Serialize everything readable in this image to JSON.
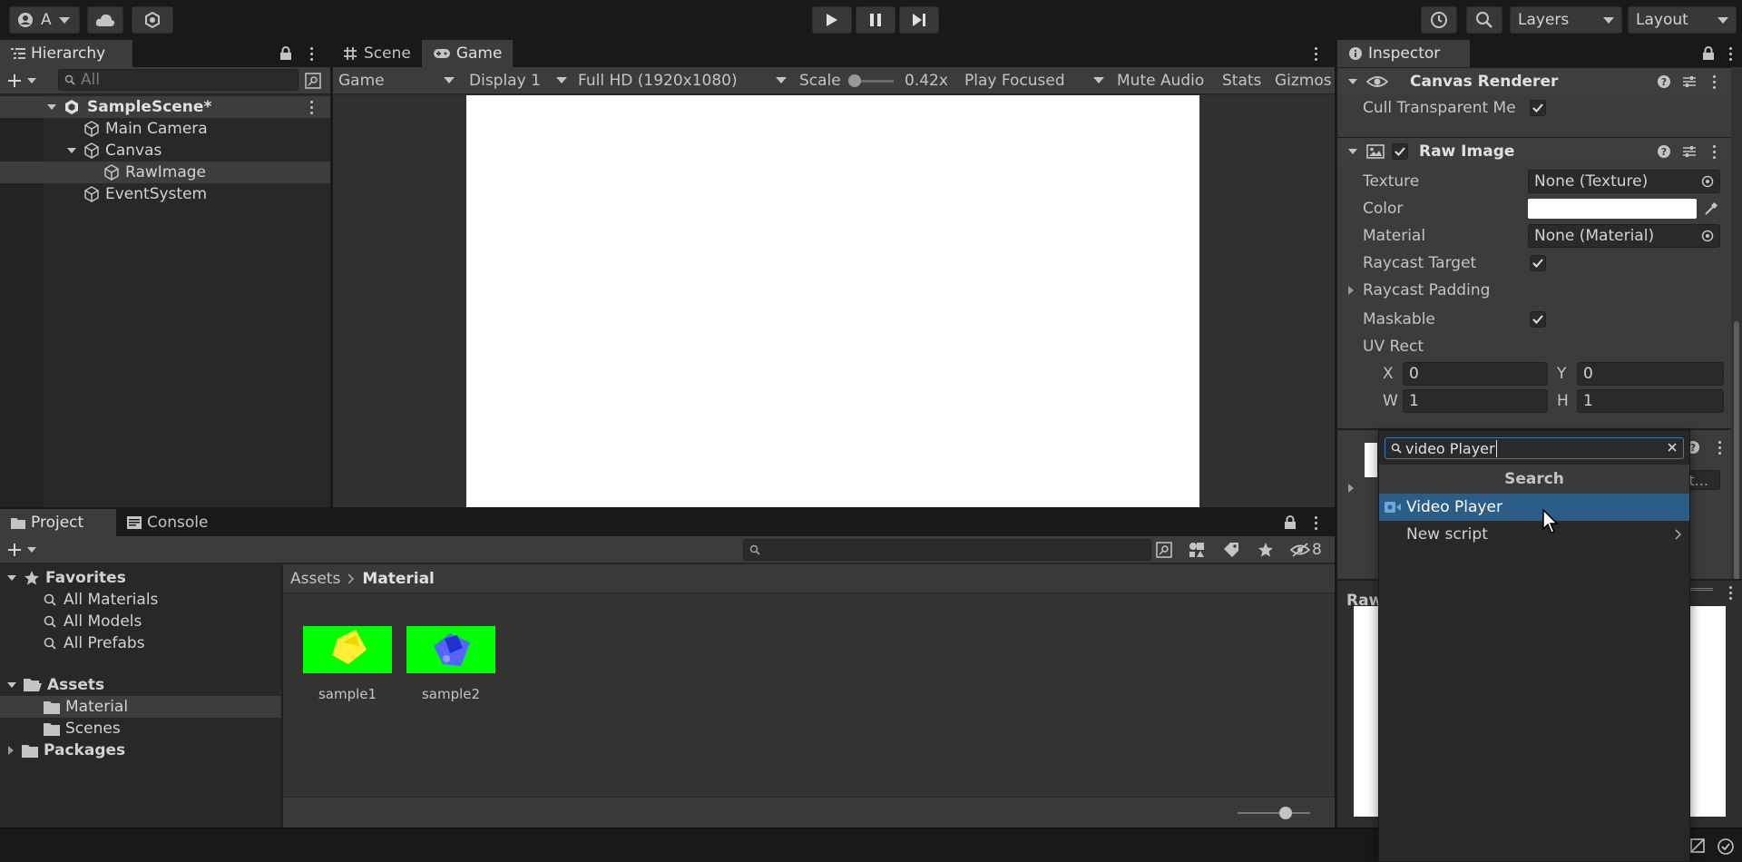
{
  "toolbar": {
    "account_label": "A",
    "layers_label": "Layers",
    "layout_label": "Layout"
  },
  "hierarchy": {
    "tab_label": "Hierarchy",
    "search_placeholder": "All",
    "scene_name": "SampleScene*",
    "items": [
      {
        "label": "Main Camera"
      },
      {
        "label": "Canvas"
      },
      {
        "label": "RawImage"
      },
      {
        "label": "EventSystem"
      }
    ]
  },
  "game_view": {
    "tabs": [
      {
        "label": "Scene"
      },
      {
        "label": "Game"
      }
    ],
    "display_mode": "Game",
    "display": "Display 1",
    "resolution": "Full HD (1920x1080)",
    "scale_label": "Scale",
    "scale_value": "0.42x",
    "play_mode": "Play Focused",
    "mute_audio": "Mute Audio",
    "stats": "Stats",
    "gizmos": "Gizmos"
  },
  "project": {
    "tabs": [
      {
        "label": "Project"
      },
      {
        "label": "Console"
      }
    ],
    "favorites_label": "Favorites",
    "favorites": [
      {
        "label": "All Materials"
      },
      {
        "label": "All Models"
      },
      {
        "label": "All Prefabs"
      }
    ],
    "assets_label": "Assets",
    "asset_folders": [
      {
        "label": "Material"
      },
      {
        "label": "Scenes"
      }
    ],
    "packages_label": "Packages",
    "breadcrumb": [
      "Assets",
      "Material"
    ],
    "hidden_count": "8",
    "files": [
      {
        "label": "sample1",
        "bg": "#00ff00",
        "fg": "#ffee33"
      },
      {
        "label": "sample2",
        "bg": "#00ff00",
        "fg": "#3344ff"
      }
    ]
  },
  "inspector": {
    "tab_label": "Inspector",
    "canvas_renderer": {
      "title": "Canvas Renderer",
      "cull_label": "Cull Transparent Me"
    },
    "raw_image": {
      "title": "Raw Image",
      "texture_label": "Texture",
      "texture_value": "None (Texture)",
      "color_label": "Color",
      "color_value": "#ffffff",
      "material_label": "Material",
      "material_value": "None (Material)",
      "raycast_target_label": "Raycast Target",
      "raycast_padding_label": "Raycast Padding",
      "maskable_label": "Maskable",
      "uv_rect_label": "UV Rect",
      "uv": {
        "x_label": "X",
        "x": "0",
        "y_label": "Y",
        "y": "0",
        "w_label": "W",
        "w": "1",
        "h_label": "H",
        "h": "1"
      }
    },
    "preview_label": "Raw",
    "add_button_fragment": "it..."
  },
  "add_component_popup": {
    "search_value": "video Player",
    "header": "Search",
    "items": [
      {
        "label": "Video Player"
      },
      {
        "label": "New script"
      }
    ]
  },
  "colors": {
    "accent_blue": "#2c5d87",
    "focus_border": "#3a79bb"
  }
}
